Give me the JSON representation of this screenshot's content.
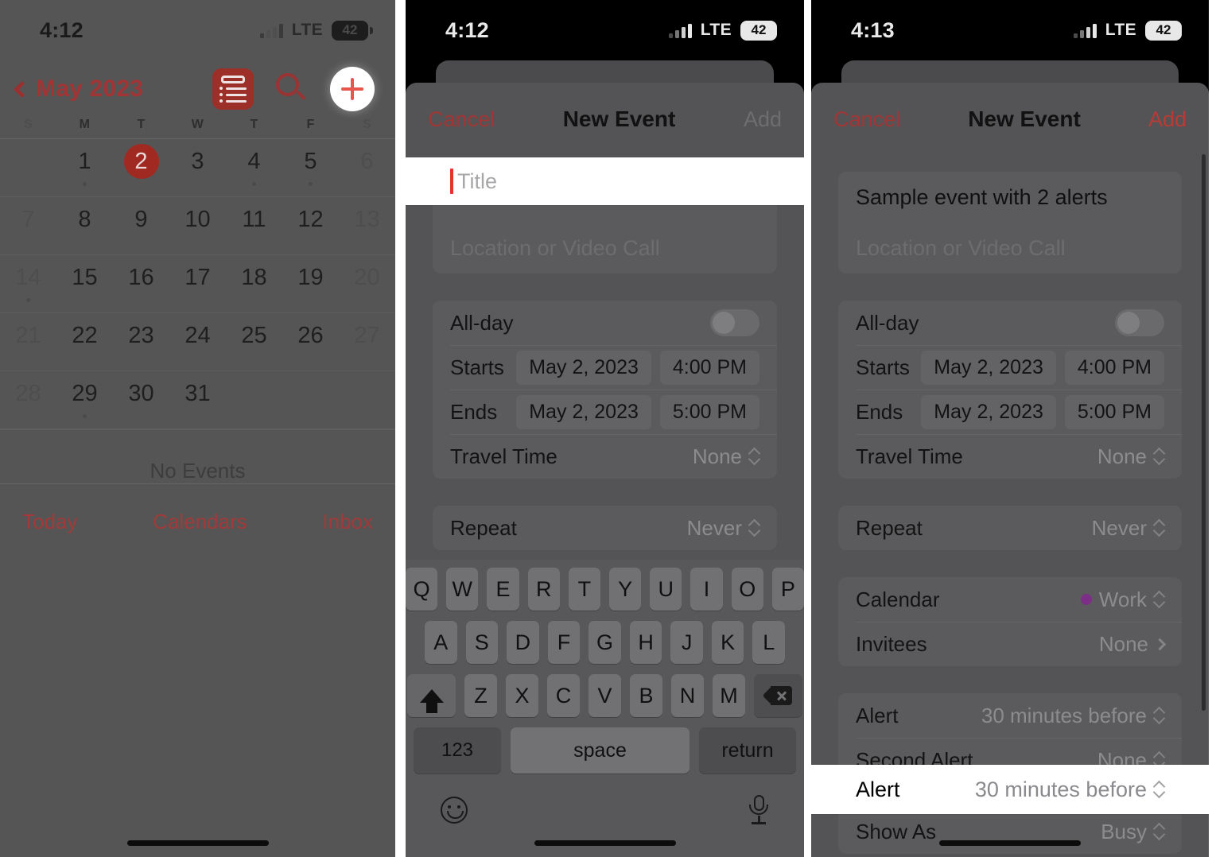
{
  "panel1": {
    "name": "calendar-month-view",
    "status": {
      "time": "4:12",
      "network": "LTE",
      "battery": "42"
    },
    "toolbar": {
      "month": "May 2023",
      "back_icon": "chevron-left-icon",
      "list_icon": "list-view-icon",
      "search_icon": "search-icon",
      "add_icon": "plus-icon"
    },
    "weekdays": [
      "S",
      "M",
      "T",
      "W",
      "T",
      "F",
      "S"
    ],
    "weeks": [
      [
        {
          "d": "",
          "we": true,
          "dot": false
        },
        {
          "d": "1",
          "we": false,
          "dot": true
        },
        {
          "d": "2",
          "we": false,
          "dot": false,
          "sel": true
        },
        {
          "d": "3",
          "we": false,
          "dot": false
        },
        {
          "d": "4",
          "we": false,
          "dot": true
        },
        {
          "d": "5",
          "we": false,
          "dot": true
        },
        {
          "d": "6",
          "we": true,
          "dot": false
        }
      ],
      [
        {
          "d": "7",
          "we": true,
          "dot": false
        },
        {
          "d": "8",
          "we": false,
          "dot": false
        },
        {
          "d": "9",
          "we": false,
          "dot": false
        },
        {
          "d": "10",
          "we": false,
          "dot": false
        },
        {
          "d": "11",
          "we": false,
          "dot": false
        },
        {
          "d": "12",
          "we": false,
          "dot": false
        },
        {
          "d": "13",
          "we": true,
          "dot": false
        }
      ],
      [
        {
          "d": "14",
          "we": true,
          "dot": true
        },
        {
          "d": "15",
          "we": false,
          "dot": false
        },
        {
          "d": "16",
          "we": false,
          "dot": false
        },
        {
          "d": "17",
          "we": false,
          "dot": false
        },
        {
          "d": "18",
          "we": false,
          "dot": false
        },
        {
          "d": "19",
          "we": false,
          "dot": false
        },
        {
          "d": "20",
          "we": true,
          "dot": false
        }
      ],
      [
        {
          "d": "21",
          "we": true,
          "dot": false
        },
        {
          "d": "22",
          "we": false,
          "dot": false
        },
        {
          "d": "23",
          "we": false,
          "dot": false
        },
        {
          "d": "24",
          "we": false,
          "dot": false
        },
        {
          "d": "25",
          "we": false,
          "dot": false
        },
        {
          "d": "26",
          "we": false,
          "dot": false
        },
        {
          "d": "27",
          "we": true,
          "dot": false
        }
      ],
      [
        {
          "d": "28",
          "we": true,
          "dot": false
        },
        {
          "d": "29",
          "we": false,
          "dot": true
        },
        {
          "d": "30",
          "we": false,
          "dot": false
        },
        {
          "d": "31",
          "we": false,
          "dot": false
        },
        {
          "d": "",
          "we": false,
          "dot": false
        },
        {
          "d": "",
          "we": false,
          "dot": false
        },
        {
          "d": "",
          "we": true,
          "dot": false
        }
      ]
    ],
    "no_events": "No Events",
    "tabbar": {
      "today": "Today",
      "calendars": "Calendars",
      "inbox": "Inbox"
    }
  },
  "panel2": {
    "name": "new-event-sheet-empty",
    "status": {
      "time": "4:12",
      "network": "LTE",
      "battery": "42"
    },
    "nav": {
      "cancel": "Cancel",
      "title": "New Event",
      "add": "Add",
      "add_state": "disabled"
    },
    "title_field": {
      "placeholder": "Title",
      "value": ""
    },
    "location_field": {
      "placeholder": "Location or Video Call"
    },
    "rows": {
      "allday": {
        "label": "All-day",
        "state": "off"
      },
      "starts": {
        "label": "Starts",
        "date": "May 2, 2023",
        "time": "4:00 PM"
      },
      "ends": {
        "label": "Ends",
        "date": "May 2, 2023",
        "time": "5:00 PM"
      },
      "travel": {
        "label": "Travel Time",
        "value": "None"
      },
      "repeat": {
        "label": "Repeat",
        "value": "Never"
      }
    },
    "keyboard": {
      "row1": [
        "Q",
        "W",
        "E",
        "R",
        "T",
        "Y",
        "U",
        "I",
        "O",
        "P"
      ],
      "row2": [
        "A",
        "S",
        "D",
        "F",
        "G",
        "H",
        "J",
        "K",
        "L"
      ],
      "row3": [
        "Z",
        "X",
        "C",
        "V",
        "B",
        "N",
        "M"
      ],
      "shift_icon": "shift-icon",
      "backspace_icon": "backspace-icon",
      "numbers": "123",
      "space": "space",
      "return": "return",
      "emoji_icon": "emoji-icon",
      "mic_icon": "microphone-icon"
    }
  },
  "panel3": {
    "name": "new-event-sheet-filled",
    "status": {
      "time": "4:13",
      "network": "LTE",
      "battery": "42"
    },
    "nav": {
      "cancel": "Cancel",
      "title": "New Event",
      "add": "Add",
      "add_state": "enabled"
    },
    "title_field": {
      "value": "Sample event with 2 alerts"
    },
    "location_field": {
      "placeholder": "Location or Video Call"
    },
    "rows": {
      "allday": {
        "label": "All-day",
        "state": "off"
      },
      "starts": {
        "label": "Starts",
        "date": "May 2, 2023",
        "time": "4:00 PM"
      },
      "ends": {
        "label": "Ends",
        "date": "May 2, 2023",
        "time": "5:00 PM"
      },
      "travel": {
        "label": "Travel Time",
        "value": "None"
      },
      "repeat": {
        "label": "Repeat",
        "value": "Never"
      },
      "calendar": {
        "label": "Calendar",
        "value": "Work",
        "color": "#7d2e86"
      },
      "invitees": {
        "label": "Invitees",
        "value": "None"
      },
      "alert": {
        "label": "Alert",
        "value": "30 minutes before",
        "highlighted": true
      },
      "second_alert": {
        "label": "Second Alert",
        "value": "None"
      },
      "show_as": {
        "label": "Show As",
        "value": "Busy"
      }
    }
  },
  "colors": {
    "accent_red": "#e8554a",
    "calendar_work": "#7d2e86",
    "sheet_bg": "#545456",
    "dim_overlay": "#555555"
  }
}
